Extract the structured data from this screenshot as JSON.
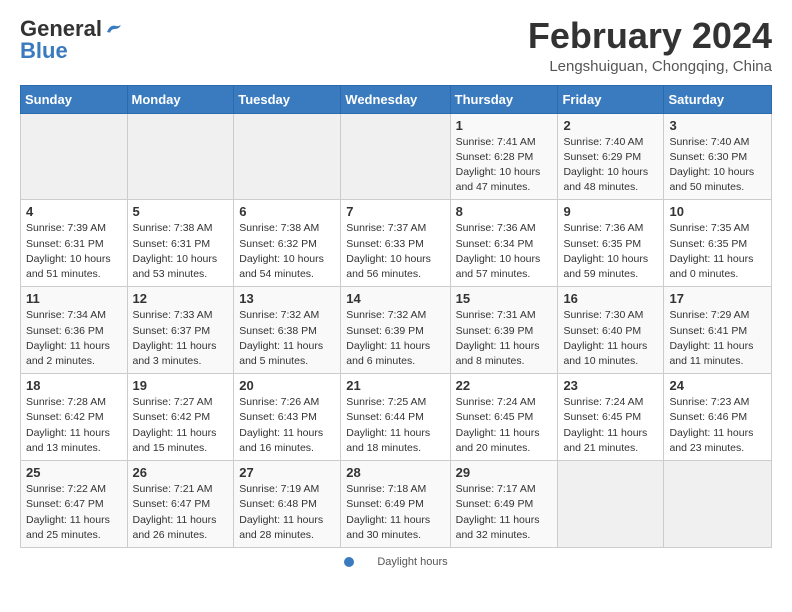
{
  "header": {
    "logo_general": "General",
    "logo_blue": "Blue",
    "month_title": "February 2024",
    "location": "Lengshuiguan, Chongqing, China"
  },
  "days_of_week": [
    "Sunday",
    "Monday",
    "Tuesday",
    "Wednesday",
    "Thursday",
    "Friday",
    "Saturday"
  ],
  "weeks": [
    [
      {
        "day": "",
        "info": ""
      },
      {
        "day": "",
        "info": ""
      },
      {
        "day": "",
        "info": ""
      },
      {
        "day": "",
        "info": ""
      },
      {
        "day": "1",
        "info": "Sunrise: 7:41 AM\nSunset: 6:28 PM\nDaylight: 10 hours and 47 minutes."
      },
      {
        "day": "2",
        "info": "Sunrise: 7:40 AM\nSunset: 6:29 PM\nDaylight: 10 hours and 48 minutes."
      },
      {
        "day": "3",
        "info": "Sunrise: 7:40 AM\nSunset: 6:30 PM\nDaylight: 10 hours and 50 minutes."
      }
    ],
    [
      {
        "day": "4",
        "info": "Sunrise: 7:39 AM\nSunset: 6:31 PM\nDaylight: 10 hours and 51 minutes."
      },
      {
        "day": "5",
        "info": "Sunrise: 7:38 AM\nSunset: 6:31 PM\nDaylight: 10 hours and 53 minutes."
      },
      {
        "day": "6",
        "info": "Sunrise: 7:38 AM\nSunset: 6:32 PM\nDaylight: 10 hours and 54 minutes."
      },
      {
        "day": "7",
        "info": "Sunrise: 7:37 AM\nSunset: 6:33 PM\nDaylight: 10 hours and 56 minutes."
      },
      {
        "day": "8",
        "info": "Sunrise: 7:36 AM\nSunset: 6:34 PM\nDaylight: 10 hours and 57 minutes."
      },
      {
        "day": "9",
        "info": "Sunrise: 7:36 AM\nSunset: 6:35 PM\nDaylight: 10 hours and 59 minutes."
      },
      {
        "day": "10",
        "info": "Sunrise: 7:35 AM\nSunset: 6:35 PM\nDaylight: 11 hours and 0 minutes."
      }
    ],
    [
      {
        "day": "11",
        "info": "Sunrise: 7:34 AM\nSunset: 6:36 PM\nDaylight: 11 hours and 2 minutes."
      },
      {
        "day": "12",
        "info": "Sunrise: 7:33 AM\nSunset: 6:37 PM\nDaylight: 11 hours and 3 minutes."
      },
      {
        "day": "13",
        "info": "Sunrise: 7:32 AM\nSunset: 6:38 PM\nDaylight: 11 hours and 5 minutes."
      },
      {
        "day": "14",
        "info": "Sunrise: 7:32 AM\nSunset: 6:39 PM\nDaylight: 11 hours and 6 minutes."
      },
      {
        "day": "15",
        "info": "Sunrise: 7:31 AM\nSunset: 6:39 PM\nDaylight: 11 hours and 8 minutes."
      },
      {
        "day": "16",
        "info": "Sunrise: 7:30 AM\nSunset: 6:40 PM\nDaylight: 11 hours and 10 minutes."
      },
      {
        "day": "17",
        "info": "Sunrise: 7:29 AM\nSunset: 6:41 PM\nDaylight: 11 hours and 11 minutes."
      }
    ],
    [
      {
        "day": "18",
        "info": "Sunrise: 7:28 AM\nSunset: 6:42 PM\nDaylight: 11 hours and 13 minutes."
      },
      {
        "day": "19",
        "info": "Sunrise: 7:27 AM\nSunset: 6:42 PM\nDaylight: 11 hours and 15 minutes."
      },
      {
        "day": "20",
        "info": "Sunrise: 7:26 AM\nSunset: 6:43 PM\nDaylight: 11 hours and 16 minutes."
      },
      {
        "day": "21",
        "info": "Sunrise: 7:25 AM\nSunset: 6:44 PM\nDaylight: 11 hours and 18 minutes."
      },
      {
        "day": "22",
        "info": "Sunrise: 7:24 AM\nSunset: 6:45 PM\nDaylight: 11 hours and 20 minutes."
      },
      {
        "day": "23",
        "info": "Sunrise: 7:24 AM\nSunset: 6:45 PM\nDaylight: 11 hours and 21 minutes."
      },
      {
        "day": "24",
        "info": "Sunrise: 7:23 AM\nSunset: 6:46 PM\nDaylight: 11 hours and 23 minutes."
      }
    ],
    [
      {
        "day": "25",
        "info": "Sunrise: 7:22 AM\nSunset: 6:47 PM\nDaylight: 11 hours and 25 minutes."
      },
      {
        "day": "26",
        "info": "Sunrise: 7:21 AM\nSunset: 6:47 PM\nDaylight: 11 hours and 26 minutes."
      },
      {
        "day": "27",
        "info": "Sunrise: 7:19 AM\nSunset: 6:48 PM\nDaylight: 11 hours and 28 minutes."
      },
      {
        "day": "28",
        "info": "Sunrise: 7:18 AM\nSunset: 6:49 PM\nDaylight: 11 hours and 30 minutes."
      },
      {
        "day": "29",
        "info": "Sunrise: 7:17 AM\nSunset: 6:49 PM\nDaylight: 11 hours and 32 minutes."
      },
      {
        "day": "",
        "info": ""
      },
      {
        "day": "",
        "info": ""
      }
    ]
  ],
  "footer": {
    "daylight_label": "Daylight hours"
  }
}
